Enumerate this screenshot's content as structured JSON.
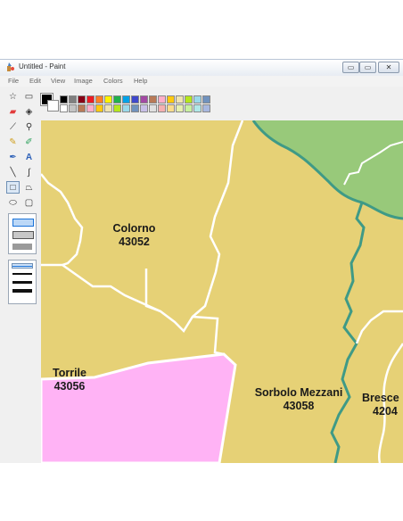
{
  "window": {
    "title": "Untitled - Paint"
  },
  "controls": {
    "minimize": "▭",
    "maximize": "▭",
    "close": "✕"
  },
  "menu": [
    "File",
    "Edit",
    "View",
    "Image",
    "Colors",
    "Help"
  ],
  "tools": [
    "free-select",
    "rect-select",
    "eraser",
    "fill",
    "color-picker",
    "magnifier",
    "pencil",
    "brush",
    "airbrush",
    "text",
    "line",
    "curve",
    "rectangle",
    "polygon",
    "ellipse",
    "rounded-rectangle"
  ],
  "colors": {
    "foreground": "#000000",
    "background": "#ffffff",
    "palette_top": [
      "#000000",
      "#7f7f7f",
      "#880015",
      "#ed1c24",
      "#ff7f27",
      "#fff200",
      "#22b14c",
      "#00a2e8",
      "#3f48cc",
      "#a349a4",
      "#b97a57",
      "#ffaec9",
      "#ffc90e",
      "#efe4b0",
      "#b5e61d",
      "#99d9ea",
      "#7092be",
      "#c8bfe7"
    ],
    "palette_bottom": [
      "#ffffff",
      "#c3c3c3",
      "#b97a57",
      "#ffaec9",
      "#ffc90e",
      "#efe4b0",
      "#b5e61d",
      "#99d9ea",
      "#7092be",
      "#c8bfe7",
      "#e0e0e0",
      "#f5b0b0",
      "#fadc8c",
      "#e6f0b0",
      "#c8f0a0",
      "#b0e8e8",
      "#a8b8e0",
      "#d8c8f0"
    ],
    "map_fill": "#e6d176",
    "map_green": "#98c97a",
    "map_pink": "#ffb3f5",
    "river": "#3f9a86"
  },
  "map": {
    "labels": [
      {
        "name": "Colorno",
        "code": "43052"
      },
      {
        "name": "Torrile",
        "code": "43056"
      },
      {
        "name": "Sorbolo Mezzani",
        "code": "43058"
      },
      {
        "name": "Bresce",
        "code": "4204"
      }
    ]
  }
}
